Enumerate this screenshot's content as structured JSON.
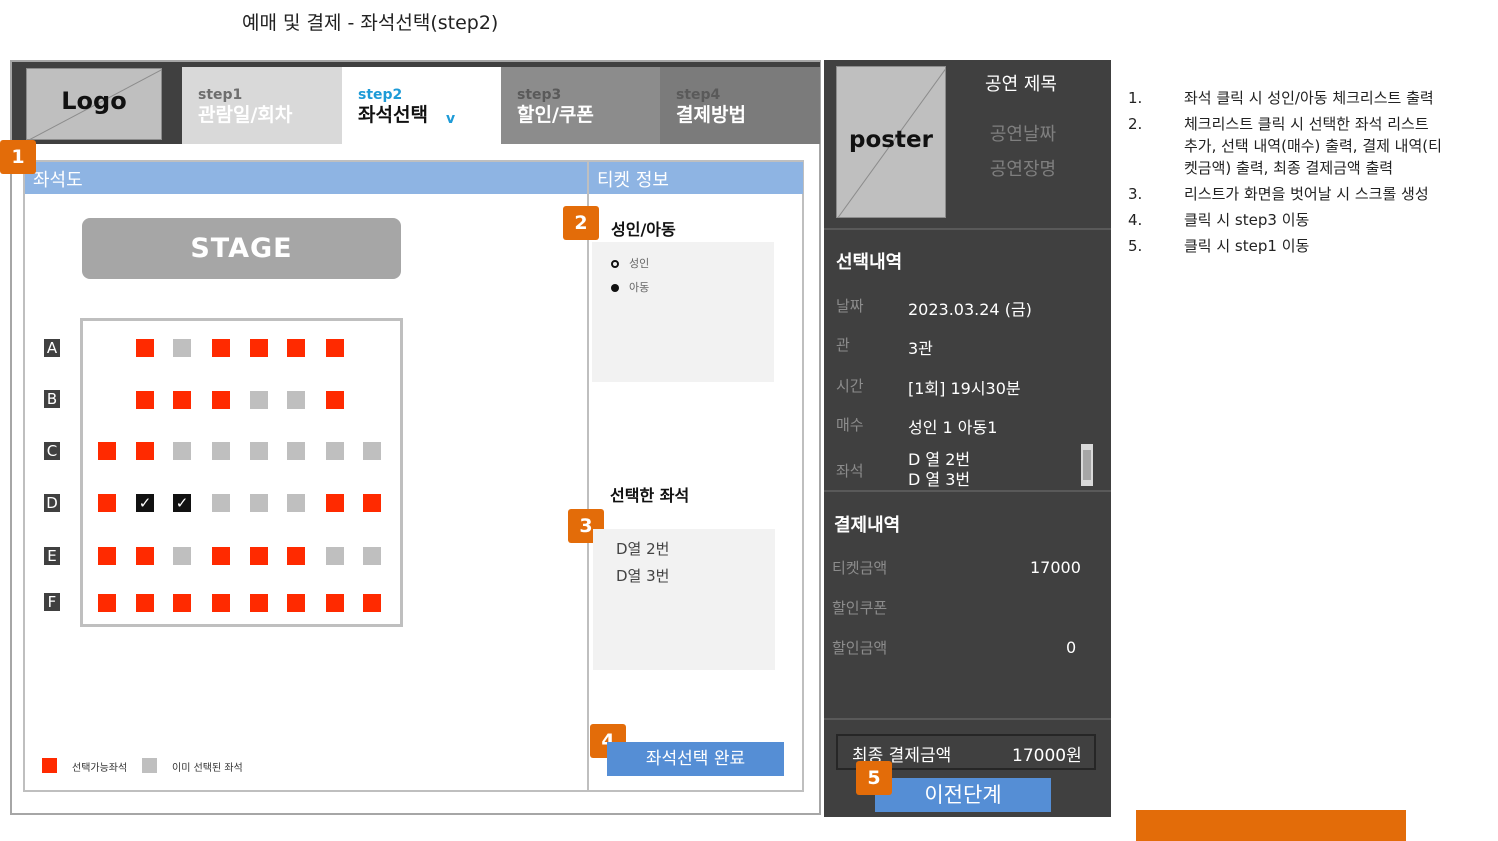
{
  "page_title": "예매 및 결제 - 좌석선택(step2)",
  "logo": "Logo",
  "steps": [
    {
      "num": "step1",
      "label": "관람일/회차"
    },
    {
      "num": "step2",
      "label": "좌석선택",
      "chevron": "v"
    },
    {
      "num": "step3",
      "label": "할인/쿠폰"
    },
    {
      "num": "step4",
      "label": "결제방법"
    }
  ],
  "badges": [
    "1",
    "2",
    "3",
    "4",
    "5"
  ],
  "seat_map": {
    "header": "좌석도",
    "stage": "STAGE",
    "rows": [
      "A",
      "B",
      "C",
      "D",
      "E",
      "F"
    ],
    "selected_mark": "✓",
    "legend": {
      "available": "선택가능좌석",
      "taken": "이미 선택된 좌석"
    }
  },
  "ticket_info": {
    "header": "티켓 정보",
    "age_title": "성인/아동",
    "age_options": [
      "성인",
      "아동"
    ],
    "selected_title": "선택한 좌석",
    "selected_seats": [
      "D열 2번",
      "D열 3번"
    ],
    "complete_button": "좌석선택 완료"
  },
  "sidebar": {
    "poster": "poster",
    "perf_title": "공연 제목",
    "perf_date": "공연날짜",
    "perf_venue": "공연장명",
    "selection_head": "선택내역",
    "selection": {
      "date_key": "날짜",
      "date_val": "2023.03.24 (금)",
      "hall_key": "관",
      "hall_val": "3관",
      "time_key": "시간",
      "time_val": "[1회] 19시30분",
      "count_key": "매수",
      "count_val": "성인 1 아동1",
      "seat_key": "좌석",
      "seat_vals": [
        "D 열 2번",
        "D 열 3번"
      ]
    },
    "payment_head": "결제내역",
    "payment": {
      "ticket_key": "티켓금액",
      "ticket_val": "17000",
      "coupon_key": "할인쿠폰",
      "discount_key": "할인금액",
      "discount_val": "0"
    },
    "final_label": "최종 결제금액",
    "final_val": "17000원",
    "prev_button": "이전단계"
  },
  "notes": [
    {
      "num": "1.",
      "lines": [
        "좌석 클릭 시 성인/아동 체크리스트 출력"
      ]
    },
    {
      "num": "2.",
      "lines": [
        "체크리스트 클릭 시 선택한 좌석 리스트",
        "추가, 선택 내역(매수) 출력, 결제 내역(티",
        "켓금액) 출력, 최종 결제금액 출력"
      ]
    },
    {
      "num": "3.",
      "lines": [
        "리스트가 화면을 벗어날 시 스크롤 생성"
      ]
    },
    {
      "num": "4.",
      "lines": [
        "클릭 시 step3 이동"
      ]
    },
    {
      "num": "5.",
      "lines": [
        "클릭 시 step1 이동"
      ]
    }
  ],
  "colors": {
    "available_seat": "#ff2a00",
    "taken_seat": "#bfbfbf",
    "selected_seat": "#111111",
    "badge": "#e36c09",
    "panel_header": "#8eb4e3",
    "button": "#558ed5",
    "active_step": "#1e9bd7",
    "sidebar_bg": "#404040"
  }
}
